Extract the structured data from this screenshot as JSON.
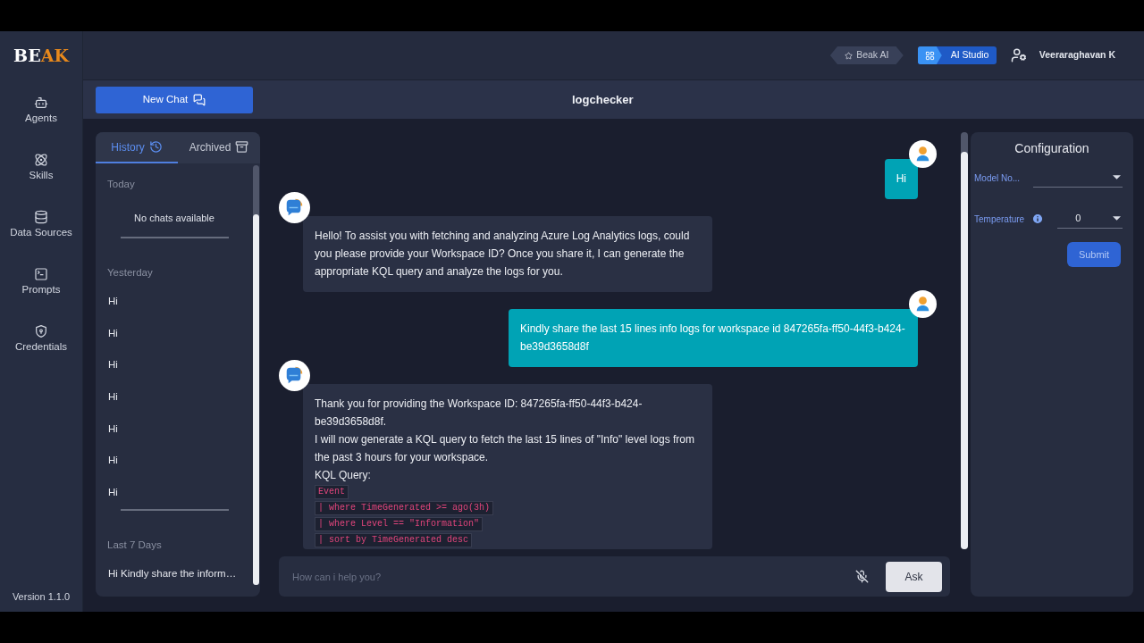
{
  "logo": {
    "parts": [
      {
        "text": "BE",
        "accent": false
      },
      {
        "text": "AK",
        "accent": true
      }
    ]
  },
  "nav": {
    "items": [
      {
        "label": "Agents",
        "selected": false
      },
      {
        "label": "Skills",
        "selected": false
      },
      {
        "label": "Data Sources",
        "selected": false
      },
      {
        "label": "Prompts",
        "selected": false
      },
      {
        "label": "Credentials",
        "selected": false
      }
    ]
  },
  "version": "Version 1.1.0",
  "top_bar": {
    "switcher": [
      {
        "label": "Beak AI",
        "selected": false
      },
      {
        "label": "AI Studio",
        "selected": true
      }
    ],
    "user": {
      "name": "Veeraraghavan K"
    }
  },
  "new_chat_button": {
    "label": "New Chat"
  },
  "chat_title": "logchecker",
  "history_panel": {
    "tabs": [
      {
        "label": "History",
        "selected": true
      },
      {
        "label": "Archived",
        "selected": false
      }
    ],
    "groups": [
      {
        "heading": "Today",
        "empty_text": "No chats available"
      },
      {
        "heading": "Yesterday",
        "items": [
          {
            "label": "Hi",
            "selected": false
          },
          {
            "label": "Hi",
            "selected": false
          },
          {
            "label": "Hi",
            "selected": false
          },
          {
            "label": "Hi",
            "selected": false
          },
          {
            "label": "Hi",
            "selected": false
          },
          {
            "label": "Hi",
            "selected": false
          },
          {
            "label": "Hi",
            "selected": false
          }
        ]
      },
      {
        "heading": "Last 7 Days",
        "items": [
          {
            "label": "Hi Kindly share the inform…",
            "selected": false
          }
        ]
      }
    ]
  },
  "chat": {
    "messages": [
      {
        "kind": "user",
        "text": "Hi"
      },
      {
        "kind": "assistant",
        "blocks": [
          {
            "kind": "text",
            "text": "Hello! To assist you with fetching and analyzing Azure Log Analytics logs, could you please provide your Workspace ID? Once you share it, I can generate the appropriate KQL query and analyze the logs for you."
          }
        ]
      },
      {
        "kind": "user",
        "text": "Kindly share the last 15 lines info logs for workspace id 847265fa-ff50-44f3-b424-be39d3658d8f"
      },
      {
        "kind": "assistant",
        "blocks": [
          {
            "kind": "text",
            "text": "Thank you for providing the Workspace ID: 847265fa-ff50-44f3-b424-be39d3658d8f."
          },
          {
            "kind": "text",
            "text": "I will now generate a KQL query to fetch the last 15 lines of \"Info\" level logs from the past 3 hours for your workspace."
          },
          {
            "kind": "text",
            "text": "KQL Query:"
          },
          {
            "kind": "code",
            "text": "Event"
          },
          {
            "kind": "code",
            "text": "| where TimeGenerated >= ago(3h)"
          },
          {
            "kind": "code",
            "text": "| where Level == \"Information\""
          },
          {
            "kind": "code",
            "text": "| sort by TimeGenerated desc"
          }
        ]
      }
    ],
    "composer": {
      "placeholder": "How can i help you?",
      "send_button": "Ask"
    }
  },
  "configuration": {
    "title": "Configuration",
    "fields": [
      {
        "label": "Model No...",
        "info_icon": false
      },
      {
        "label": "Temperature",
        "value": "0",
        "info_icon": true
      }
    ],
    "submit_button": "Submit"
  }
}
